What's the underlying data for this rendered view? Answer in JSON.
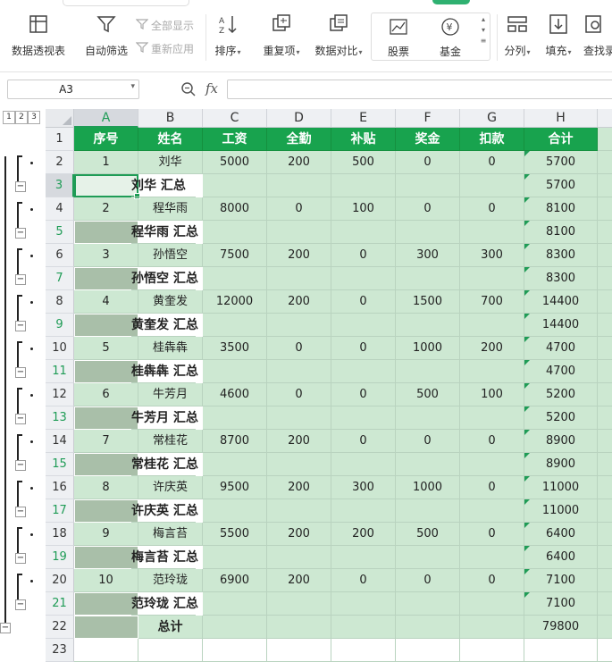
{
  "ribbon": {
    "buttons": [
      {
        "label": "数据透视表",
        "icon": "pivot-table-icon"
      },
      {
        "label": "自动筛选",
        "icon": "filter-icon"
      },
      {
        "label": "排序",
        "icon": "sort-icon"
      },
      {
        "label": "重复项",
        "icon": "duplicate-icon"
      },
      {
        "label": "数据对比",
        "icon": "compare-icon"
      },
      {
        "label": "分列",
        "icon": "split-column-icon"
      },
      {
        "label": "填充",
        "icon": "fill-icon"
      },
      {
        "label": "查找录",
        "icon": "lookup-icon"
      }
    ],
    "show_all": "全部显示",
    "reapply": "重新应用",
    "gallery": [
      {
        "label": "股票",
        "icon": "stock-chart-icon"
      },
      {
        "label": "基金",
        "icon": "fund-icon"
      }
    ]
  },
  "formula_bar": {
    "cell_ref": "A3",
    "fx_label": "fx",
    "formula": ""
  },
  "outline_levels": [
    "1",
    "2",
    "3"
  ],
  "columns": [
    "A",
    "B",
    "C",
    "D",
    "E",
    "F",
    "G",
    "H"
  ],
  "selected_cell": "A3",
  "headers": [
    "序号",
    "姓名",
    "工资",
    "全勤",
    "补贴",
    "奖金",
    "扣款",
    "合计"
  ],
  "rows": [
    {
      "num": "2",
      "type": "data",
      "cells": [
        "1",
        "刘华",
        "5000",
        "200",
        "500",
        "0",
        "0",
        "5700"
      ]
    },
    {
      "num": "3",
      "type": "subtotal",
      "label": "刘华 汇总",
      "total": "5700"
    },
    {
      "num": "4",
      "type": "data",
      "cells": [
        "2",
        "程华雨",
        "8000",
        "0",
        "100",
        "0",
        "0",
        "8100"
      ]
    },
    {
      "num": "5",
      "type": "subtotal",
      "label": "程华雨 汇总",
      "total": "8100"
    },
    {
      "num": "6",
      "type": "data",
      "cells": [
        "3",
        "孙悟空",
        "7500",
        "200",
        "0",
        "300",
        "300",
        "8300"
      ]
    },
    {
      "num": "7",
      "type": "subtotal",
      "label": "孙悟空 汇总",
      "total": "8300"
    },
    {
      "num": "8",
      "type": "data",
      "cells": [
        "4",
        "黄奎发",
        "12000",
        "200",
        "0",
        "1500",
        "700",
        "14400"
      ]
    },
    {
      "num": "9",
      "type": "subtotal",
      "label": "黄奎发 汇总",
      "total": "14400"
    },
    {
      "num": "10",
      "type": "data",
      "cells": [
        "5",
        "桂犇犇",
        "3500",
        "0",
        "0",
        "1000",
        "200",
        "4700"
      ]
    },
    {
      "num": "11",
      "type": "subtotal",
      "label": "桂犇犇 汇总",
      "total": "4700"
    },
    {
      "num": "12",
      "type": "data",
      "cells": [
        "6",
        "牛芳月",
        "4600",
        "0",
        "0",
        "500",
        "100",
        "5200"
      ]
    },
    {
      "num": "13",
      "type": "subtotal",
      "label": "牛芳月 汇总",
      "total": "5200"
    },
    {
      "num": "14",
      "type": "data",
      "cells": [
        "7",
        "常桂花",
        "8700",
        "200",
        "0",
        "0",
        "0",
        "8900"
      ]
    },
    {
      "num": "15",
      "type": "subtotal",
      "label": "常桂花 汇总",
      "total": "8900"
    },
    {
      "num": "16",
      "type": "data",
      "cells": [
        "8",
        "许庆英",
        "9500",
        "200",
        "300",
        "1000",
        "0",
        "11000"
      ]
    },
    {
      "num": "17",
      "type": "subtotal",
      "label": "许庆英 汇总",
      "total": "11000"
    },
    {
      "num": "18",
      "type": "data",
      "cells": [
        "9",
        "梅言苔",
        "5500",
        "200",
        "200",
        "500",
        "0",
        "6400"
      ]
    },
    {
      "num": "19",
      "type": "subtotal",
      "label": "梅言苔 汇总",
      "total": "6400"
    },
    {
      "num": "20",
      "type": "data",
      "cells": [
        "10",
        "范玲珑",
        "6900",
        "200",
        "0",
        "0",
        "0",
        "7100"
      ]
    },
    {
      "num": "21",
      "type": "subtotal",
      "label": "范玲珑 汇总",
      "total": "7100"
    },
    {
      "num": "22",
      "type": "grand",
      "label": "总计",
      "total": "79800"
    },
    {
      "num": "23",
      "type": "blank"
    }
  ],
  "colors": {
    "header_green": "#18a34e",
    "cell_green": "#cde8d2",
    "accent": "#1f9c56",
    "gray_cell": "#a9bfa9"
  }
}
